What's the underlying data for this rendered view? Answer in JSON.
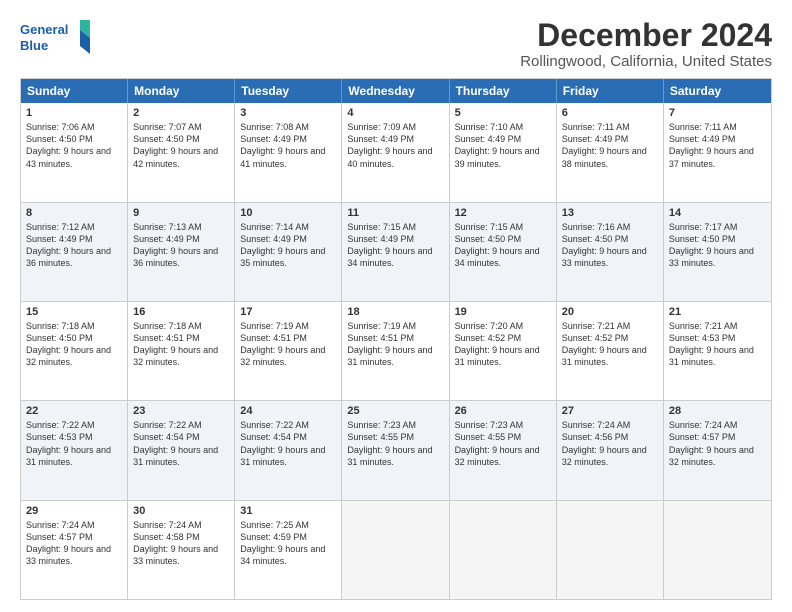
{
  "logo": {
    "line1": "General",
    "line2": "Blue"
  },
  "title": "December 2024",
  "subtitle": "Rollingwood, California, United States",
  "header": {
    "days": [
      "Sunday",
      "Monday",
      "Tuesday",
      "Wednesday",
      "Thursday",
      "Friday",
      "Saturday"
    ]
  },
  "weeks": [
    {
      "alt": false,
      "cells": [
        {
          "day": "1",
          "rise": "Sunrise: 7:06 AM",
          "set": "Sunset: 4:50 PM",
          "light": "Daylight: 9 hours and 43 minutes."
        },
        {
          "day": "2",
          "rise": "Sunrise: 7:07 AM",
          "set": "Sunset: 4:50 PM",
          "light": "Daylight: 9 hours and 42 minutes."
        },
        {
          "day": "3",
          "rise": "Sunrise: 7:08 AM",
          "set": "Sunset: 4:49 PM",
          "light": "Daylight: 9 hours and 41 minutes."
        },
        {
          "day": "4",
          "rise": "Sunrise: 7:09 AM",
          "set": "Sunset: 4:49 PM",
          "light": "Daylight: 9 hours and 40 minutes."
        },
        {
          "day": "5",
          "rise": "Sunrise: 7:10 AM",
          "set": "Sunset: 4:49 PM",
          "light": "Daylight: 9 hours and 39 minutes."
        },
        {
          "day": "6",
          "rise": "Sunrise: 7:11 AM",
          "set": "Sunset: 4:49 PM",
          "light": "Daylight: 9 hours and 38 minutes."
        },
        {
          "day": "7",
          "rise": "Sunrise: 7:11 AM",
          "set": "Sunset: 4:49 PM",
          "light": "Daylight: 9 hours and 37 minutes."
        }
      ]
    },
    {
      "alt": true,
      "cells": [
        {
          "day": "8",
          "rise": "Sunrise: 7:12 AM",
          "set": "Sunset: 4:49 PM",
          "light": "Daylight: 9 hours and 36 minutes."
        },
        {
          "day": "9",
          "rise": "Sunrise: 7:13 AM",
          "set": "Sunset: 4:49 PM",
          "light": "Daylight: 9 hours and 36 minutes."
        },
        {
          "day": "10",
          "rise": "Sunrise: 7:14 AM",
          "set": "Sunset: 4:49 PM",
          "light": "Daylight: 9 hours and 35 minutes."
        },
        {
          "day": "11",
          "rise": "Sunrise: 7:15 AM",
          "set": "Sunset: 4:49 PM",
          "light": "Daylight: 9 hours and 34 minutes."
        },
        {
          "day": "12",
          "rise": "Sunrise: 7:15 AM",
          "set": "Sunset: 4:50 PM",
          "light": "Daylight: 9 hours and 34 minutes."
        },
        {
          "day": "13",
          "rise": "Sunrise: 7:16 AM",
          "set": "Sunset: 4:50 PM",
          "light": "Daylight: 9 hours and 33 minutes."
        },
        {
          "day": "14",
          "rise": "Sunrise: 7:17 AM",
          "set": "Sunset: 4:50 PM",
          "light": "Daylight: 9 hours and 33 minutes."
        }
      ]
    },
    {
      "alt": false,
      "cells": [
        {
          "day": "15",
          "rise": "Sunrise: 7:18 AM",
          "set": "Sunset: 4:50 PM",
          "light": "Daylight: 9 hours and 32 minutes."
        },
        {
          "day": "16",
          "rise": "Sunrise: 7:18 AM",
          "set": "Sunset: 4:51 PM",
          "light": "Daylight: 9 hours and 32 minutes."
        },
        {
          "day": "17",
          "rise": "Sunrise: 7:19 AM",
          "set": "Sunset: 4:51 PM",
          "light": "Daylight: 9 hours and 32 minutes."
        },
        {
          "day": "18",
          "rise": "Sunrise: 7:19 AM",
          "set": "Sunset: 4:51 PM",
          "light": "Daylight: 9 hours and 31 minutes."
        },
        {
          "day": "19",
          "rise": "Sunrise: 7:20 AM",
          "set": "Sunset: 4:52 PM",
          "light": "Daylight: 9 hours and 31 minutes."
        },
        {
          "day": "20",
          "rise": "Sunrise: 7:21 AM",
          "set": "Sunset: 4:52 PM",
          "light": "Daylight: 9 hours and 31 minutes."
        },
        {
          "day": "21",
          "rise": "Sunrise: 7:21 AM",
          "set": "Sunset: 4:53 PM",
          "light": "Daylight: 9 hours and 31 minutes."
        }
      ]
    },
    {
      "alt": true,
      "cells": [
        {
          "day": "22",
          "rise": "Sunrise: 7:22 AM",
          "set": "Sunset: 4:53 PM",
          "light": "Daylight: 9 hours and 31 minutes."
        },
        {
          "day": "23",
          "rise": "Sunrise: 7:22 AM",
          "set": "Sunset: 4:54 PM",
          "light": "Daylight: 9 hours and 31 minutes."
        },
        {
          "day": "24",
          "rise": "Sunrise: 7:22 AM",
          "set": "Sunset: 4:54 PM",
          "light": "Daylight: 9 hours and 31 minutes."
        },
        {
          "day": "25",
          "rise": "Sunrise: 7:23 AM",
          "set": "Sunset: 4:55 PM",
          "light": "Daylight: 9 hours and 31 minutes."
        },
        {
          "day": "26",
          "rise": "Sunrise: 7:23 AM",
          "set": "Sunset: 4:55 PM",
          "light": "Daylight: 9 hours and 32 minutes."
        },
        {
          "day": "27",
          "rise": "Sunrise: 7:24 AM",
          "set": "Sunset: 4:56 PM",
          "light": "Daylight: 9 hours and 32 minutes."
        },
        {
          "day": "28",
          "rise": "Sunrise: 7:24 AM",
          "set": "Sunset: 4:57 PM",
          "light": "Daylight: 9 hours and 32 minutes."
        }
      ]
    },
    {
      "alt": false,
      "cells": [
        {
          "day": "29",
          "rise": "Sunrise: 7:24 AM",
          "set": "Sunset: 4:57 PM",
          "light": "Daylight: 9 hours and 33 minutes."
        },
        {
          "day": "30",
          "rise": "Sunrise: 7:24 AM",
          "set": "Sunset: 4:58 PM",
          "light": "Daylight: 9 hours and 33 minutes."
        },
        {
          "day": "31",
          "rise": "Sunrise: 7:25 AM",
          "set": "Sunset: 4:59 PM",
          "light": "Daylight: 9 hours and 34 minutes."
        },
        {
          "day": "",
          "rise": "",
          "set": "",
          "light": ""
        },
        {
          "day": "",
          "rise": "",
          "set": "",
          "light": ""
        },
        {
          "day": "",
          "rise": "",
          "set": "",
          "light": ""
        },
        {
          "day": "",
          "rise": "",
          "set": "",
          "light": ""
        }
      ]
    }
  ]
}
